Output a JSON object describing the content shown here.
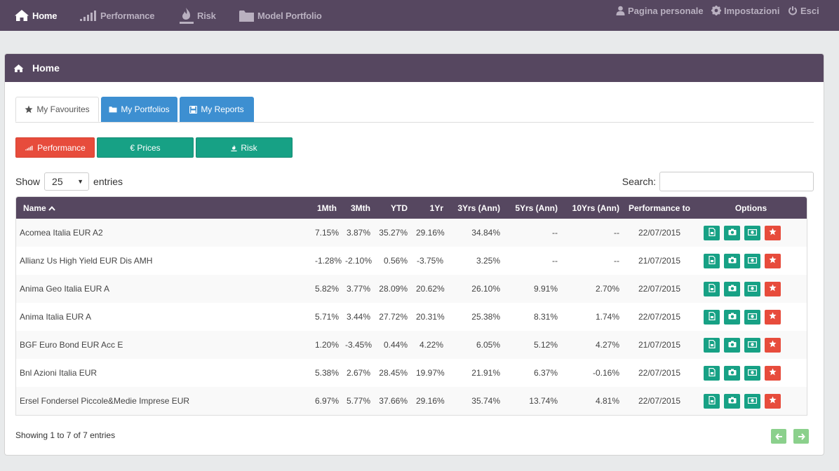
{
  "nav": {
    "home": "Home",
    "performance": "Performance",
    "risk": "Risk",
    "model_portfolio": "Model Portfolio",
    "personal_page": "Pagina personale",
    "settings": "Impostazioni",
    "logout": "Esci"
  },
  "panel": {
    "title": "Home"
  },
  "tabs": {
    "favourites": "My Favourites",
    "portfolios": "My Portfolios",
    "reports": "My Reports"
  },
  "buttons": {
    "performance": "Performance",
    "prices": "€ Prices",
    "risk": "Risk"
  },
  "length": {
    "show": "Show",
    "value": "25",
    "entries": "entries"
  },
  "search": {
    "label": "Search:",
    "value": ""
  },
  "table": {
    "headers": [
      "Name",
      "1Mth",
      "3Mth",
      "YTD",
      "1Yr",
      "3Yrs (Ann)",
      "5Yrs (Ann)",
      "10Yrs (Ann)",
      "Performance to",
      "Options"
    ],
    "rows": [
      [
        "Acomea Italia EUR A2",
        "7.15%",
        "3.87%",
        "35.27%",
        "29.16%",
        "34.84%",
        "--",
        "--",
        "22/07/2015"
      ],
      [
        "Allianz Us High Yield EUR Dis AMH",
        "-1.28%",
        "-2.10%",
        "0.56%",
        "-3.75%",
        "3.25%",
        "--",
        "--",
        "21/07/2015"
      ],
      [
        "Anima Geo Italia EUR A",
        "5.82%",
        "3.77%",
        "28.09%",
        "20.62%",
        "26.10%",
        "9.91%",
        "2.70%",
        "22/07/2015"
      ],
      [
        "Anima Italia EUR A",
        "5.71%",
        "3.44%",
        "27.72%",
        "20.31%",
        "25.38%",
        "8.31%",
        "1.74%",
        "22/07/2015"
      ],
      [
        "BGF Euro Bond EUR Acc E",
        "1.20%",
        "-3.45%",
        "0.44%",
        "4.22%",
        "6.05%",
        "5.12%",
        "4.27%",
        "21/07/2015"
      ],
      [
        "Bnl Azioni Italia EUR",
        "5.38%",
        "2.67%",
        "28.45%",
        "19.97%",
        "21.91%",
        "6.37%",
        "-0.16%",
        "22/07/2015"
      ],
      [
        "Ersel Fondersel Piccole&Medie Imprese EUR",
        "6.97%",
        "5.77%",
        "37.66%",
        "29.16%",
        "35.74%",
        "13.74%",
        "4.81%",
        "22/07/2015"
      ]
    ]
  },
  "footer": {
    "info": "Showing 1 to 7 of 7 entries"
  },
  "icons": {
    "home": "home-icon",
    "performance": "signal-bars-icon",
    "risk": "flame-icon",
    "model_portfolio": "folder-icon",
    "user": "user-icon",
    "settings": "gear-icon",
    "logout": "power-icon",
    "star": "star-icon",
    "save": "floppy-icon",
    "sort": "sort-up-icon",
    "row_options": [
      "document-icon",
      "camera-icon",
      "money-icon",
      "star-icon"
    ],
    "prev": "arrow-left-icon",
    "next": "arrow-right-icon"
  },
  "colors": {
    "nav": "#564760",
    "blue": "#3d8fd1",
    "green": "#17a185",
    "red": "#e74c3c",
    "pager": "#8bd08c"
  }
}
